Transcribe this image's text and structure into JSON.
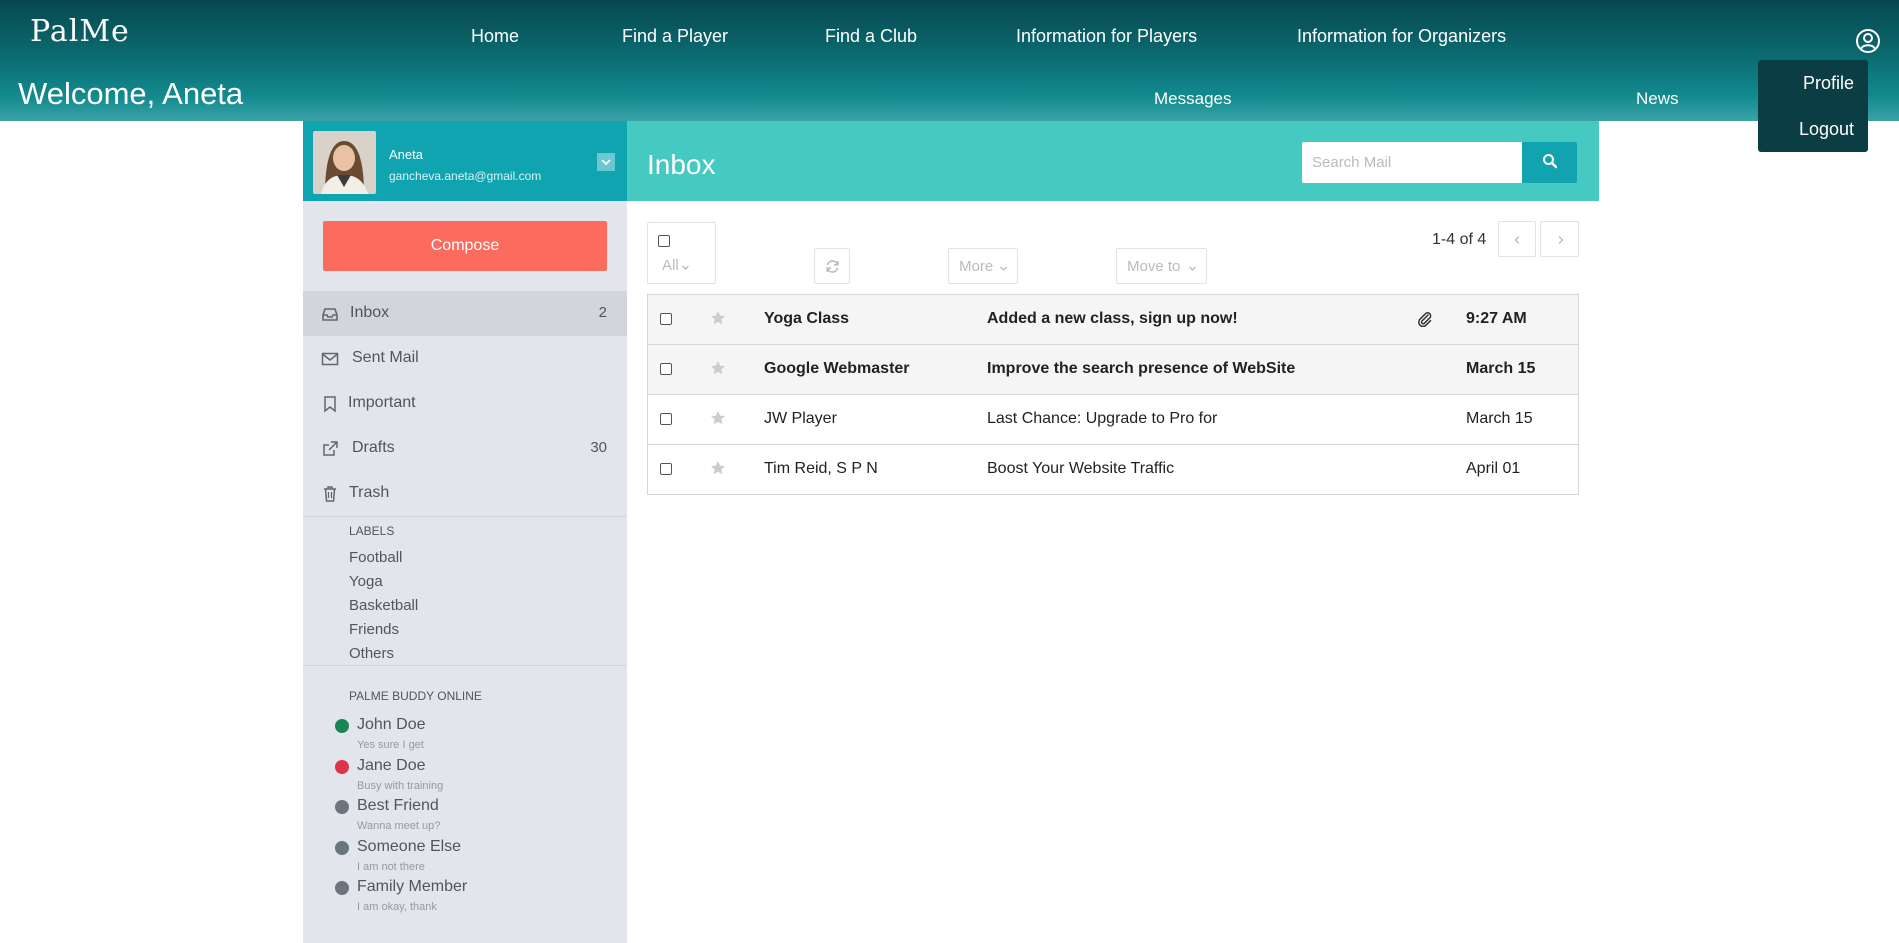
{
  "brand": {
    "logo_text": "PalMe"
  },
  "nav": {
    "items": [
      "Home",
      "Find a Player",
      "Find a Club",
      "Information for Players",
      "Information for Organizers"
    ],
    "welcome": "Welcome, Aneta",
    "messages": "Messages",
    "news": "News"
  },
  "user_menu": {
    "profile": "Profile",
    "logout": "Logout"
  },
  "profile": {
    "name": "Aneta",
    "email": "gancheva.aneta@gmail.com"
  },
  "compose_label": "Compose",
  "folders": [
    {
      "label": "Inbox",
      "count": "2",
      "icon": "inbox-icon"
    },
    {
      "label": "Sent Mail",
      "count": "",
      "icon": "envelope-icon"
    },
    {
      "label": "Important",
      "count": "",
      "icon": "bookmark-icon"
    },
    {
      "label": "Drafts",
      "count": "30",
      "icon": "external-link-icon"
    },
    {
      "label": "Trash",
      "count": "",
      "icon": "trash-icon"
    }
  ],
  "labels": {
    "title": "LABELS",
    "items": [
      "Football",
      "Yoga",
      "Basketball",
      "Friends",
      "Others"
    ]
  },
  "buddies": {
    "title": "PALME BUDDY ONLINE",
    "items": [
      {
        "name": "John Doe",
        "status": "Yes sure I get",
        "color": "#198754"
      },
      {
        "name": "Jane Doe",
        "status": "Busy with training",
        "color": "#dc3545"
      },
      {
        "name": "Best Friend",
        "status": "Wanna meet up?",
        "color": "#6c757d"
      },
      {
        "name": "Someone Else",
        "status": "I am not there",
        "color": "#6c757d"
      },
      {
        "name": "Family Member",
        "status": "I am okay, thank",
        "color": "#6c757d"
      }
    ]
  },
  "inbox": {
    "title": "Inbox",
    "search_placeholder": "Search Mail",
    "toolbar": {
      "all": "All",
      "more": "More",
      "move_to": "Move to"
    },
    "pager": "1-4 of 4",
    "rows": [
      {
        "sender": "Yoga Class",
        "subject": "Added a new class, sign up now!",
        "date": "9:27 AM",
        "unread": true,
        "attachment": true
      },
      {
        "sender": "Google Webmaster",
        "subject": "Improve the search presence of WebSite",
        "date": "March 15",
        "unread": true,
        "attachment": false
      },
      {
        "sender": "JW Player",
        "subject": "Last Chance: Upgrade to Pro for",
        "date": "March 15",
        "unread": false,
        "attachment": false
      },
      {
        "sender": "Tim Reid, S P N",
        "subject": "Boost Your Website Traffic",
        "date": "April 01",
        "unread": false,
        "attachment": false
      }
    ]
  },
  "colors": {
    "header_teal": "#0a6a70",
    "sidebar_head": "#10a4b1",
    "inbox_head": "#46c9c1",
    "compose": "#fc6c5e",
    "sidebar_bg": "#e2e5ec"
  }
}
